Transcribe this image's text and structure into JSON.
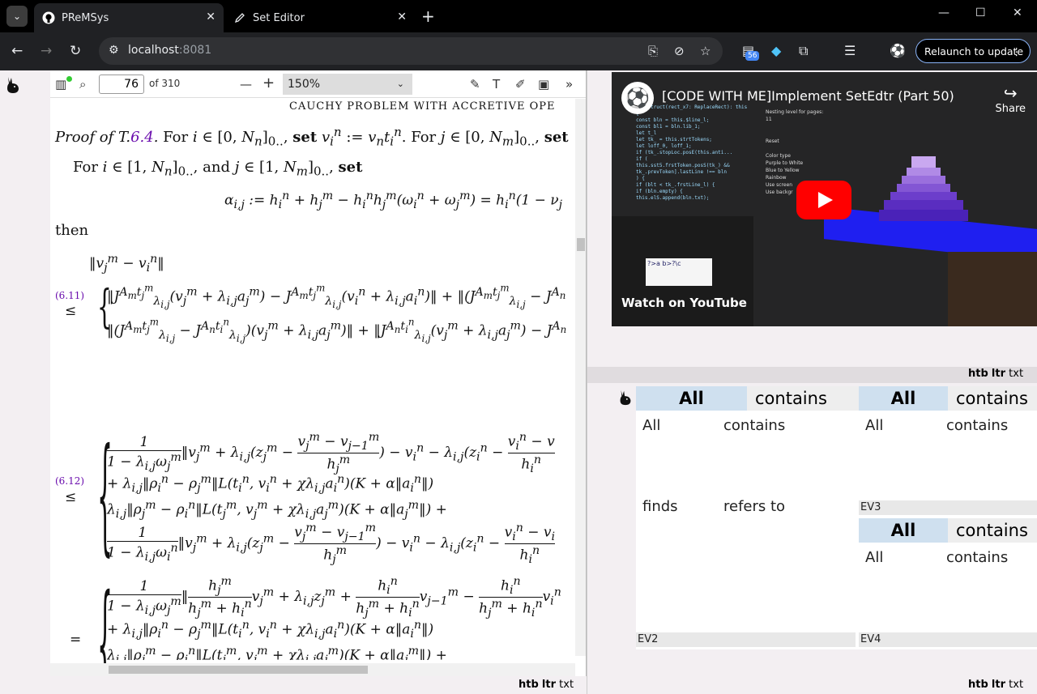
{
  "browser": {
    "tabs": [
      {
        "title": "PReMSys",
        "close": "✕"
      },
      {
        "title": "Set Editor",
        "close": "✕"
      }
    ],
    "url_host": "localhost",
    "url_port": ":8081",
    "extensions_badge": "56",
    "relaunch_label": "Relaunch to update",
    "window_controls": [
      "—",
      "☐",
      "✕"
    ]
  },
  "pdf": {
    "page": "76",
    "page_total": "of 310",
    "zoom": "150%",
    "running_head": "CAUCHY PROBLEM WITH ACCRETIVE OPE",
    "lines": {
      "proof": "Proof of T.6.4. For i ∈ [0, N",
      "proof_tail": "]0.., set v",
      "for_line": "For i ∈ [1, N",
      "alpha": "α",
      "then": "then",
      "norm": "‖v",
      "eq611": "(6.11)",
      "eq612": "(6.12)"
    }
  },
  "footer_left": {
    "htb": "htb",
    "ltr": "ltr",
    "txt": "txt"
  },
  "footer_right_mid": {
    "htb": "htb",
    "ltr": "ltr",
    "txt": "txt"
  },
  "footer_right_bot": {
    "htb": "htb",
    "ltr": "ltr",
    "txt": "txt"
  },
  "video": {
    "title": "[CODE WITH ME]Implement SetEdtr (Part 50)",
    "share": "Share",
    "watch_on": "Watch on",
    "youtube": "YouTube"
  },
  "sets": {
    "all": "All",
    "contains": "contains",
    "finds": "finds",
    "refers_to": "refers to",
    "ev2": "EV2",
    "ev3": "EV3",
    "ev4": "EV4"
  }
}
